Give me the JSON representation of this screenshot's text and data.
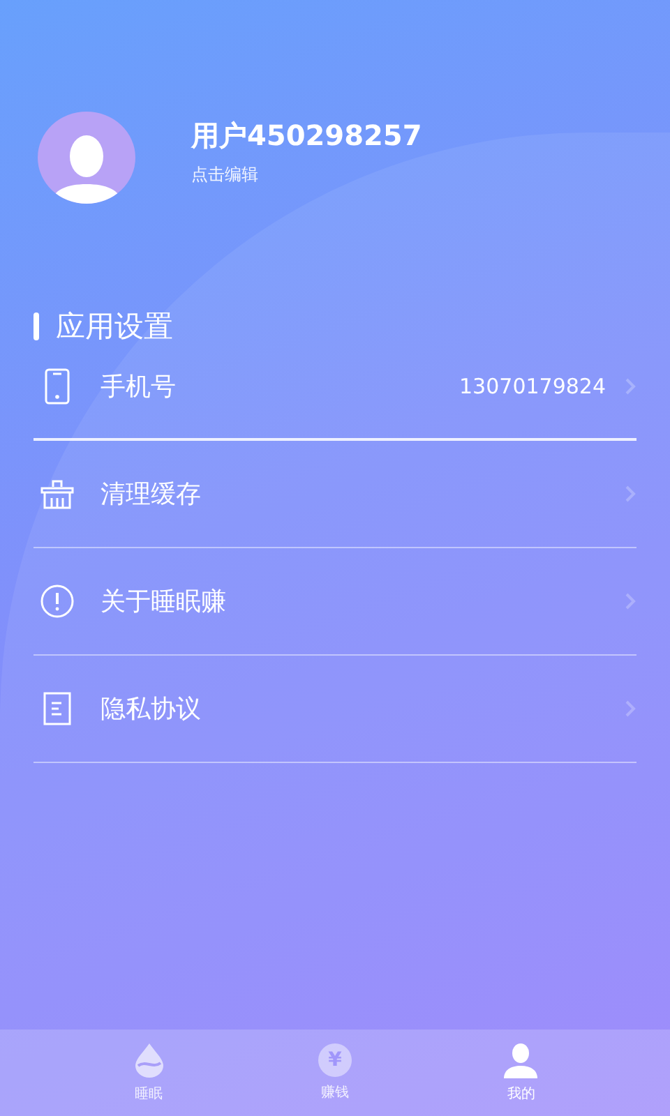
{
  "profile": {
    "username": "用户450298257",
    "hint": "点击编辑"
  },
  "section": {
    "title": "应用设置"
  },
  "settings": [
    {
      "kind": "phone",
      "label": "手机号",
      "value": "13070179824"
    },
    {
      "kind": "cache",
      "label": "清理缓存"
    },
    {
      "kind": "about",
      "label": "关于睡眠赚"
    },
    {
      "kind": "privacy",
      "label": "隐私协议"
    }
  ],
  "tabs": [
    {
      "kind": "sleep",
      "label": "睡眠",
      "selected": false
    },
    {
      "kind": "earn",
      "label": "赚钱",
      "glyph": "¥",
      "selected": false
    },
    {
      "kind": "mine",
      "label": "我的",
      "selected": true
    }
  ]
}
